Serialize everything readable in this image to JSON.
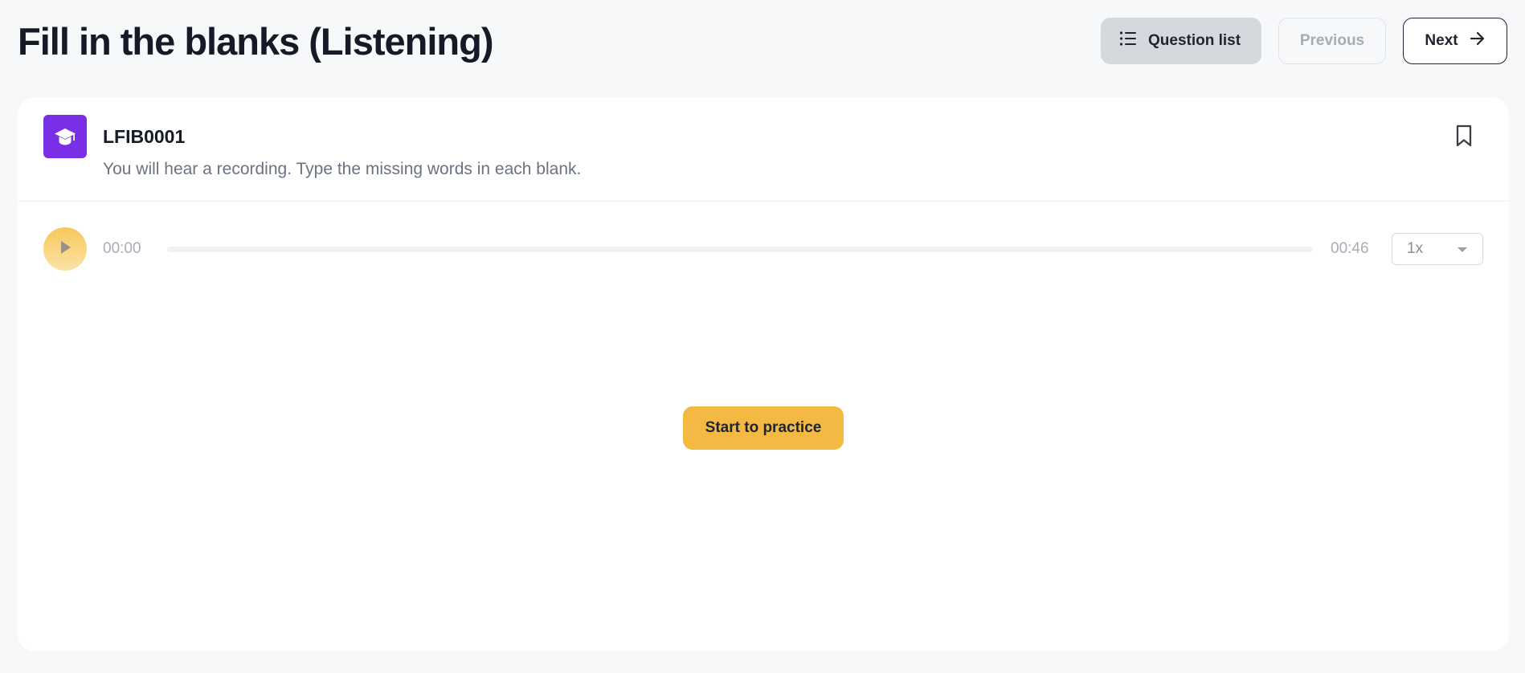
{
  "header": {
    "title": "Fill in the blanks (Listening)",
    "question_list_label": "Question list",
    "previous_label": "Previous",
    "next_label": "Next"
  },
  "question": {
    "id": "LFIB0001",
    "instruction": "You will hear a recording. Type the missing words in each blank.",
    "icon": "graduation-cap-icon",
    "bookmark_icon": "bookmark-icon"
  },
  "player": {
    "current_time": "00:00",
    "total_time": "00:46",
    "progress_fraction": 0,
    "speed": "1x"
  },
  "main": {
    "start_label": "Start to practice"
  },
  "colors": {
    "accent": "#f4b942",
    "icon_bg": "#7a2fe6",
    "text_dark": "#161a26",
    "muted": "#6b7280"
  }
}
